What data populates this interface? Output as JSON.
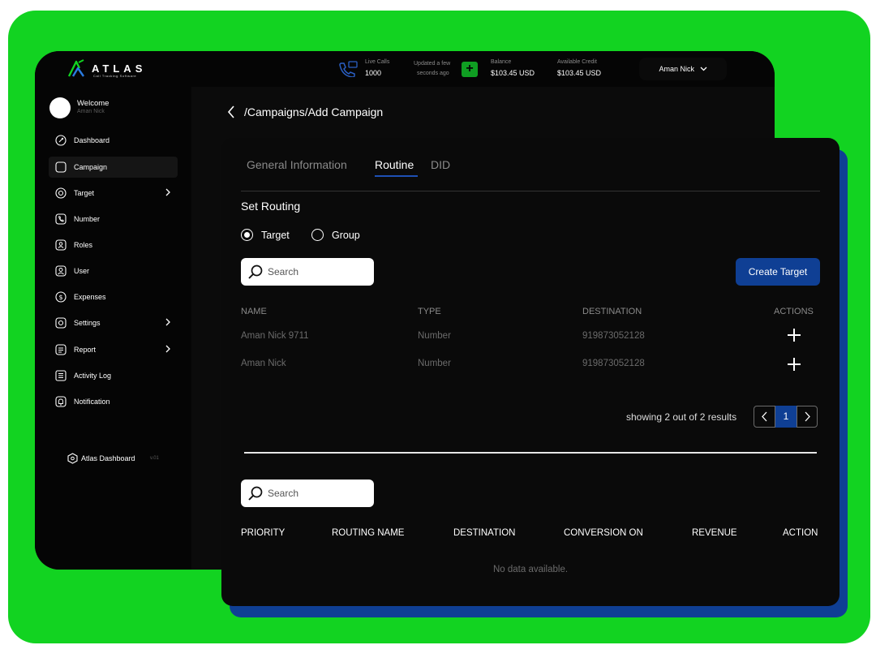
{
  "brand": {
    "name": "ATLAS",
    "tagline": "Call Tracking Software",
    "color": "#12d321",
    "accent": "#0f3f94"
  },
  "topbar": {
    "live_calls_label": "Live Calls",
    "live_calls_value": "1000",
    "updated_line1": "Updated a few",
    "updated_line2": "seconds ago",
    "balance_label": "Balance",
    "balance_value": "$103.45 USD",
    "credit_label": "Available Credit",
    "credit_value": "$103.45 USD",
    "user_name": "Aman Nick"
  },
  "sidebar": {
    "welcome": "Welcome",
    "user": "Aman Nick",
    "items": [
      {
        "label": "Dashboard",
        "icon": "dashboard-icon"
      },
      {
        "label": "Campaign",
        "icon": "campaign-icon",
        "active": true
      },
      {
        "label": "Target",
        "icon": "target-icon",
        "chevron": true
      },
      {
        "label": "Number",
        "icon": "phone-icon"
      },
      {
        "label": "Roles",
        "icon": "roles-icon"
      },
      {
        "label": "User",
        "icon": "user-icon"
      },
      {
        "label": "Expenses",
        "icon": "expenses-icon"
      },
      {
        "label": "Settings",
        "icon": "settings-icon",
        "chevron": true
      },
      {
        "label": "Report",
        "icon": "report-icon",
        "chevron": true
      },
      {
        "label": "Activity Log",
        "icon": "activity-log-icon"
      },
      {
        "label": "Notification",
        "icon": "bell-icon"
      }
    ],
    "footer_label": "Atlas Dashboard",
    "footer_version": "v.01"
  },
  "breadcrumb": "/Campaigns/Add Campaign",
  "tabs": [
    "General Information",
    "Routine",
    "DID"
  ],
  "active_tab": "Routine",
  "routing": {
    "title": "Set Routing",
    "option_target": "Target",
    "option_group": "Group",
    "selected": "Target"
  },
  "search_placeholder": "Search",
  "create_button": "Create Target",
  "targets_table": {
    "headers": [
      "NAME",
      "TYPE",
      "DESTINATION",
      "ACTIONS"
    ],
    "rows": [
      [
        "Aman Nick 9711",
        "Number",
        "919873052128"
      ],
      [
        "Aman Nick",
        "Number",
        "919873052128"
      ]
    ]
  },
  "pagination": {
    "summary": "showing 2 out of 2 results",
    "current_page": "1"
  },
  "routing_table": {
    "headers": [
      "PRIORITY",
      "ROUTING NAME",
      "DESTINATION",
      "CONVERSION ON",
      "REVENUE",
      "ACTION"
    ],
    "empty": "No data available."
  }
}
